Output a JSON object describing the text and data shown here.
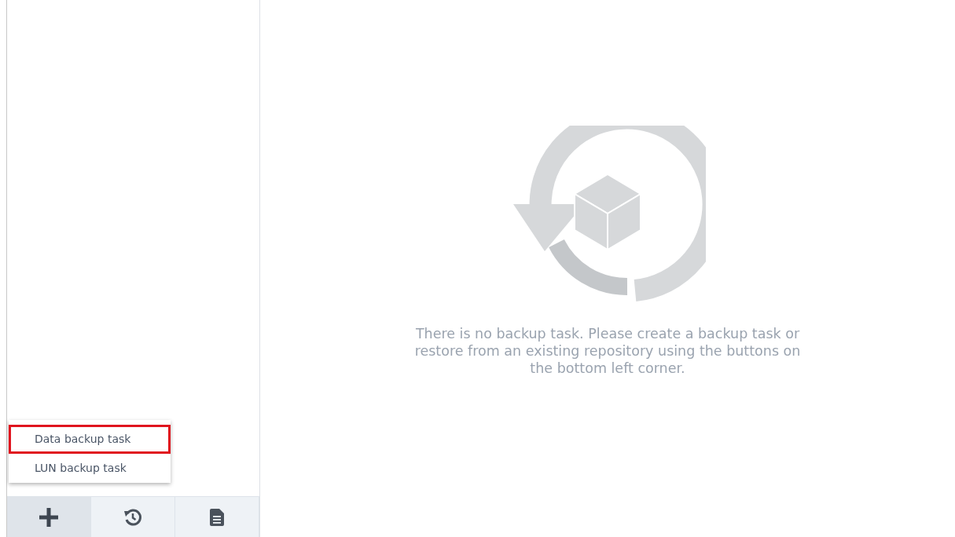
{
  "menu": [
    {
      "label": "Data backup task",
      "highlighted": true
    },
    {
      "label": "LUN backup task",
      "highlighted": false
    }
  ],
  "toolbar": [
    {
      "kind": "add",
      "selected": true
    },
    {
      "kind": "restore",
      "selected": false
    },
    {
      "kind": "log",
      "selected": false
    }
  ],
  "empty_message": "There is no backup task. Please create a backup task or restore from an existing repository using the buttons on the bottom left corner."
}
